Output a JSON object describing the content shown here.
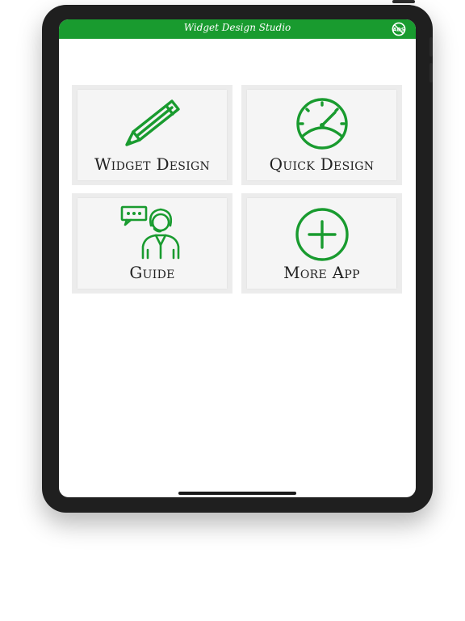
{
  "app": {
    "title": "Widget Design Studio",
    "no_ads_icon": "no-ads-icon",
    "accent_color": "#199b2f"
  },
  "menu": {
    "items": [
      {
        "label": "Widget Design",
        "icon": "pencil-icon"
      },
      {
        "label": "Quick Design",
        "icon": "speedometer-icon"
      },
      {
        "label": "Guide",
        "icon": "support-agent-icon"
      },
      {
        "label": "More App",
        "icon": "plus-circle-icon"
      }
    ]
  }
}
